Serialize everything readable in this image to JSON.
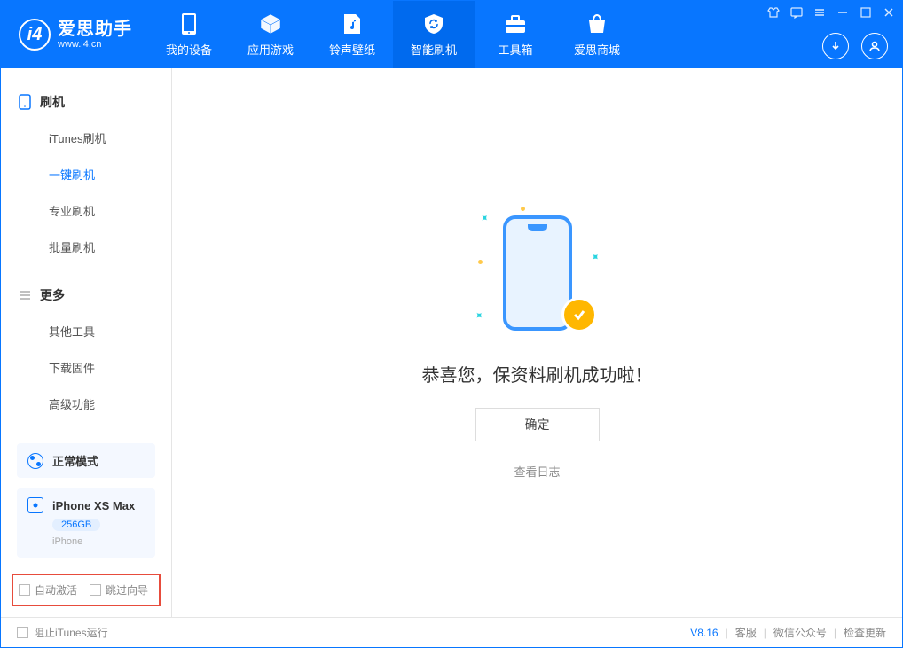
{
  "brand": {
    "title": "爱思助手",
    "subtitle": "www.i4.cn",
    "logo_letter": "i4"
  },
  "nav": {
    "tabs": [
      {
        "label": "我的设备"
      },
      {
        "label": "应用游戏"
      },
      {
        "label": "铃声壁纸"
      },
      {
        "label": "智能刷机"
      },
      {
        "label": "工具箱"
      },
      {
        "label": "爱思商城"
      }
    ],
    "active_index": 3
  },
  "sidebar": {
    "section1": {
      "title": "刷机"
    },
    "items1": [
      {
        "label": "iTunes刷机"
      },
      {
        "label": "一键刷机"
      },
      {
        "label": "专业刷机"
      },
      {
        "label": "批量刷机"
      }
    ],
    "active1_index": 1,
    "section2": {
      "title": "更多"
    },
    "items2": [
      {
        "label": "其他工具"
      },
      {
        "label": "下载固件"
      },
      {
        "label": "高级功能"
      }
    ]
  },
  "device_mode": {
    "label": "正常模式"
  },
  "device": {
    "name": "iPhone XS Max",
    "capacity": "256GB",
    "type": "iPhone"
  },
  "bottom_checks": {
    "auto_activate": "自动激活",
    "skip_guide": "跳过向导"
  },
  "main": {
    "success_title": "恭喜您，保资料刷机成功啦！",
    "confirm_label": "确定",
    "view_log_label": "查看日志"
  },
  "footer": {
    "block_itunes": "阻止iTunes运行",
    "version": "V8.16",
    "links": {
      "support": "客服",
      "wechat": "微信公众号",
      "check_update": "检查更新"
    }
  }
}
